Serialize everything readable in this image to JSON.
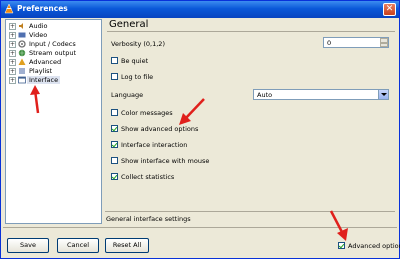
{
  "window": {
    "title": "Preferences",
    "close_glyph": "✕"
  },
  "tree": {
    "items": [
      {
        "label": "Audio",
        "icon": "audio-icon"
      },
      {
        "label": "Video",
        "icon": "video-icon"
      },
      {
        "label": "Input / Codecs",
        "icon": "codecs-icon"
      },
      {
        "label": "Stream output",
        "icon": "stream-output-icon"
      },
      {
        "label": "Advanced",
        "icon": "advanced-icon"
      },
      {
        "label": "Playlist",
        "icon": "playlist-icon"
      },
      {
        "label": "Interface",
        "icon": "interface-icon",
        "selected": true
      }
    ],
    "expander_glyph": "+"
  },
  "panel": {
    "heading": "General",
    "verbosity_label": "Verbosity (0,1,2)",
    "verbosity_value": "0",
    "be_quiet": {
      "label": "Be quiet",
      "checked": false
    },
    "log_to_file": {
      "label": "Log to file",
      "checked": false
    },
    "language_label": "Language",
    "language_value": "Auto",
    "color_messages": {
      "label": "Color messages",
      "checked": false
    },
    "show_advanced_options": {
      "label": "Show advanced options",
      "checked": true
    },
    "interface_interaction": {
      "label": "Interface interaction",
      "checked": true
    },
    "show_interface_with_mouse": {
      "label": "Show interface with mouse",
      "checked": false
    },
    "collect_statistics": {
      "label": "Collect statistics",
      "checked": true
    },
    "footer_caption": "General interface settings"
  },
  "buttons": {
    "save": "Save",
    "cancel": "Cancel",
    "reset_all": "Reset All"
  },
  "advanced_options": {
    "label": "Advanced options",
    "checked": true
  },
  "colors": {
    "titlebar": "#0a58d8",
    "annotation_arrow": "#e0201c"
  }
}
